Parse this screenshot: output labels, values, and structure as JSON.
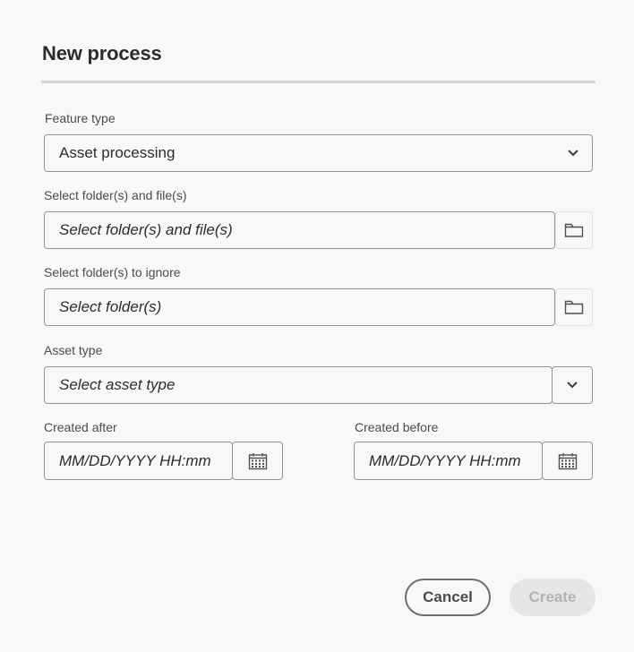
{
  "dialog": {
    "title": "New process",
    "feature_type": {
      "label": "Feature type",
      "value": "Asset processing"
    },
    "select_files": {
      "label": "Select folder(s) and file(s)",
      "placeholder": "Select folder(s) and file(s)"
    },
    "ignore_folders": {
      "label": "Select folder(s) to ignore",
      "placeholder": "Select folder(s)"
    },
    "asset_type": {
      "label": "Asset type",
      "placeholder": "Select asset type"
    },
    "created_after": {
      "label": "Created after",
      "placeholder": "MM/DD/YYYY HH:mm"
    },
    "created_before": {
      "label": "Created before",
      "placeholder": "MM/DD/YYYY HH:mm"
    },
    "buttons": {
      "cancel": "Cancel",
      "create": "Create"
    }
  },
  "icons": {
    "chevron": "chevron-down-icon",
    "folder": "folder-icon",
    "calendar": "calendar-icon"
  }
}
